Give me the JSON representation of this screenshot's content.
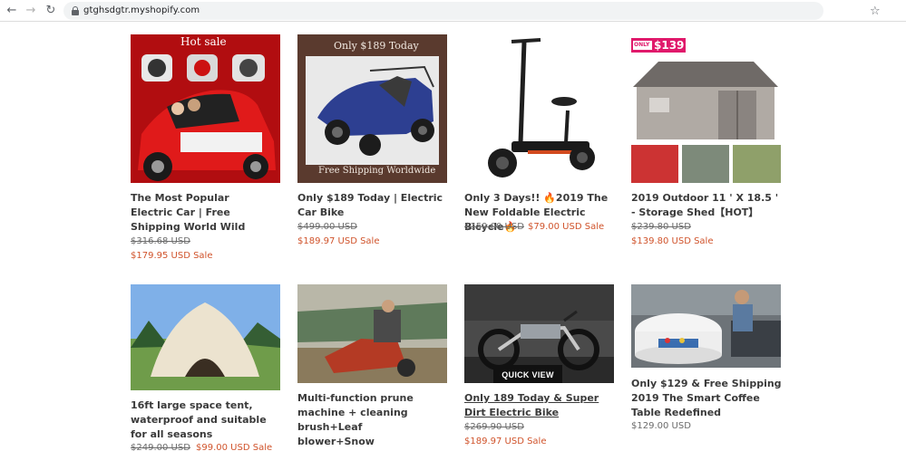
{
  "browser": {
    "url": "gtghsdgtr.myshopify.com",
    "back_icon": "arrow-left-icon",
    "forward_icon": "arrow-right-icon",
    "reload_icon": "reload-icon",
    "bookmark_icon": "star-icon"
  },
  "products": [
    {
      "image_text": [
        "Hot sale"
      ],
      "title": "The Most Popular Electric Car | Free Shipping World Wild",
      "compare_price": "$316.68 USD",
      "sale_price": "$179.95 USD Sale"
    },
    {
      "image_text": [
        "Only $189 Today",
        "Free Shipping Worldwide"
      ],
      "title": "Only $189 Today | Electric Car Bike",
      "compare_price": "$499.00 USD",
      "sale_price": "$189.97 USD Sale"
    },
    {
      "title": "Only 3 Days!! 🔥2019 The New Foldable Electric Bicycle🔥",
      "compare_price": "$159.00 USD",
      "sale_price": "$79.00 USD Sale"
    },
    {
      "image_text": [
        "ONLY",
        "$139"
      ],
      "title": "2019 Outdoor 11 ' X 18.5 ' - Storage Shed【HOT】",
      "compare_price": "$239.80 USD",
      "sale_price": "$139.80 USD Sale"
    },
    {
      "title": "16ft large space tent, waterproof and suitable for all seasons",
      "compare_price": "$249.00 USD",
      "sale_price": "$99.00 USD Sale"
    },
    {
      "title": "Multi-function prune machine + cleaning brush+Leaf blower+Snow knife+Lawn mower"
    },
    {
      "title": "Only 189 Today & Super Dirt Electric Bike",
      "compare_price": "$269.90 USD",
      "sale_price": "$189.97 USD Sale",
      "quick_view": "QUICK VIEW"
    },
    {
      "title": "Only $129 & Free Shipping 2019 The Smart Coffee Table Redefined",
      "regular_price": "$129.00 USD"
    }
  ],
  "colors": {
    "sale": "#d0532b",
    "text": "#3a3a3a",
    "muted": "#6b6b6b"
  }
}
